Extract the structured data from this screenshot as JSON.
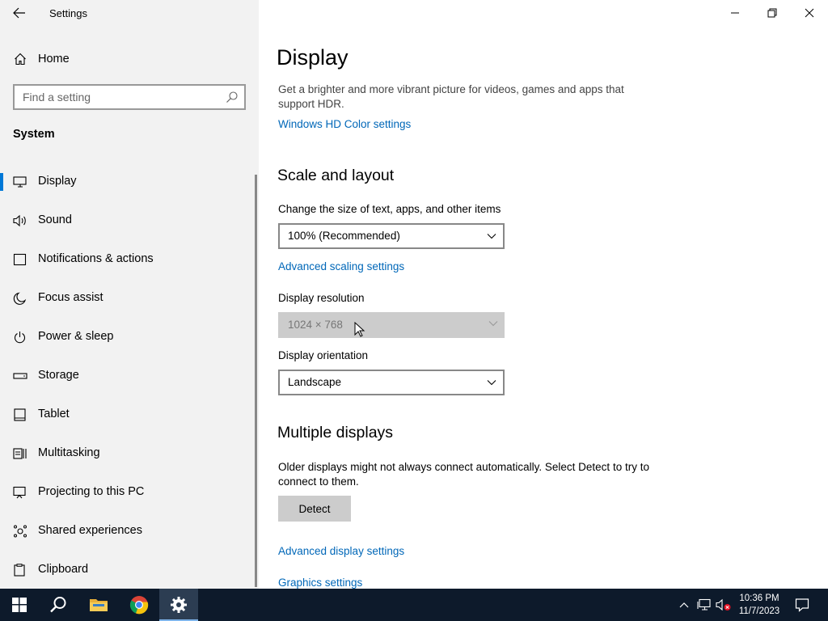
{
  "window": {
    "app_title": "Settings"
  },
  "sidebar": {
    "home_label": "Home",
    "search_placeholder": "Find a setting",
    "section_label": "System",
    "items": [
      {
        "label": "Display",
        "icon": "monitor-icon",
        "active": true
      },
      {
        "label": "Sound",
        "icon": "speaker-icon"
      },
      {
        "label": "Notifications & actions",
        "icon": "notification-icon"
      },
      {
        "label": "Focus assist",
        "icon": "moon-icon"
      },
      {
        "label": "Power & sleep",
        "icon": "power-icon"
      },
      {
        "label": "Storage",
        "icon": "storage-icon"
      },
      {
        "label": "Tablet",
        "icon": "tablet-icon"
      },
      {
        "label": "Multitasking",
        "icon": "multitasking-icon"
      },
      {
        "label": "Projecting to this PC",
        "icon": "projector-icon"
      },
      {
        "label": "Shared experiences",
        "icon": "shared-icon"
      },
      {
        "label": "Clipboard",
        "icon": "clipboard-icon"
      }
    ]
  },
  "main": {
    "page_title": "Display",
    "hdr_description": "Get a brighter and more vibrant picture for videos, games and apps that support HDR.",
    "hdr_link": "Windows HD Color settings",
    "scale_heading": "Scale and layout",
    "scale_label": "Change the size of text, apps, and other items",
    "scale_value": "100% (Recommended)",
    "advanced_scaling_link": "Advanced scaling settings",
    "resolution_label": "Display resolution",
    "resolution_value": "1024 × 768",
    "orientation_label": "Display orientation",
    "orientation_value": "Landscape",
    "multiple_heading": "Multiple displays",
    "multiple_description": "Older displays might not always connect automatically. Select Detect to try to connect to them.",
    "detect_button": "Detect",
    "advanced_display_link": "Advanced display settings",
    "graphics_link": "Graphics settings"
  },
  "taskbar": {
    "time": "10:36 PM",
    "date": "11/7/2023"
  },
  "colors": {
    "accent": "#0078d7",
    "link": "#0067b8",
    "sidebar_bg": "#f2f2f2",
    "taskbar_bg": "#0d1a2b"
  }
}
